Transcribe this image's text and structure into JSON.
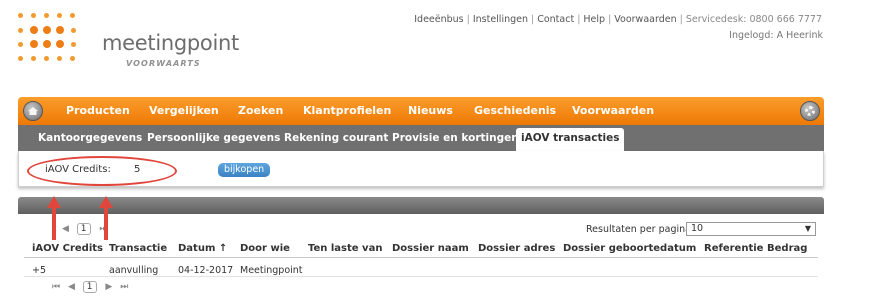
{
  "brand": {
    "name": "meetingpoint",
    "tagline": "VOORWAARTS",
    "accent": "#ee7d16"
  },
  "toplinks": {
    "links": [
      "Ideeënbus",
      "Instellingen",
      "Contact",
      "Help",
      "Voorwaarden"
    ],
    "servicedesk": "Servicedesk: 0800 666 7777",
    "logged_in": "Ingelogd: A Heerink"
  },
  "main_menu": {
    "items": [
      "Producten",
      "Vergelijken",
      "Zoeken",
      "Klantprofielen",
      "Nieuws",
      "Geschiedenis",
      "Voorwaarden"
    ],
    "home_icon": "home-icon",
    "settings_icon": "gear-icon"
  },
  "sub_menu": {
    "items": [
      "Kantoorgegevens",
      "Persoonlijke gegevens",
      "Rekening courant",
      "Provisie en kortingen",
      "iAOV transacties"
    ],
    "active": "iAOV transacties"
  },
  "credits": {
    "label": "iAOV Credits:",
    "value": "5",
    "buy_label": "bijkopen"
  },
  "grid": {
    "pager": {
      "first": "⏮",
      "prev": "◀",
      "page": "1",
      "next": "▶",
      "last": "⏭"
    },
    "per_page_label": "Resultaten per pagina:",
    "per_page_value": "10",
    "columns": [
      "iAOV Credits",
      "Transactie",
      "Datum ↑",
      "Door wie",
      "Ten laste van",
      "Dossier naam",
      "Dossier adres",
      "Dossier geboortedatum",
      "Referentie",
      "Bedrag"
    ],
    "rows": [
      [
        "+5",
        "aanvulling",
        "04-12-2017",
        "Meetingpoint",
        "",
        "",
        "",
        "",
        "",
        ""
      ]
    ]
  },
  "annotation_color": "#e0463c"
}
